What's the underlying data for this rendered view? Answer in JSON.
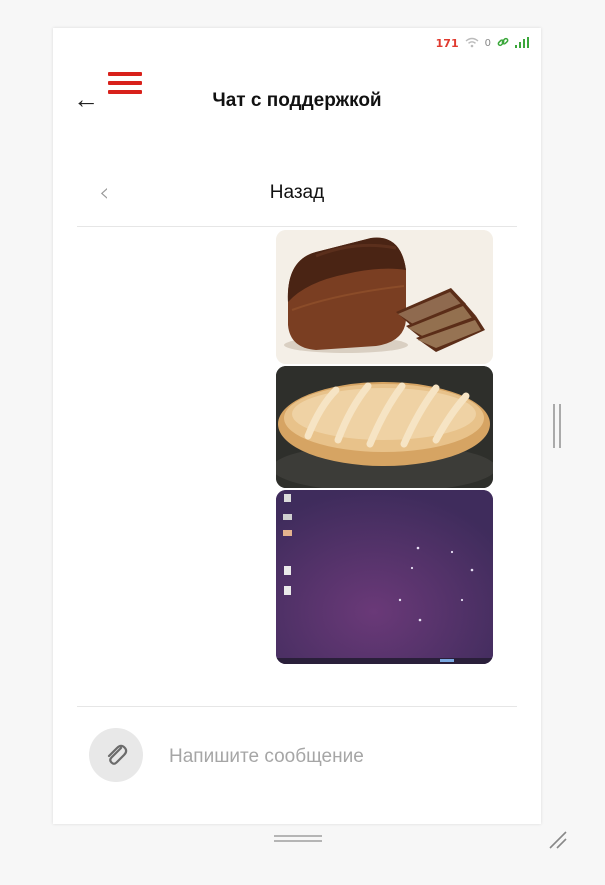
{
  "status_bar": {
    "counter": "171",
    "wifi_icon": "wifi-icon",
    "data": "0",
    "link_icon": "link-icon",
    "signal_icon": "signal-icon"
  },
  "header": {
    "title": "Чат с поддержкой",
    "back_icon": "arrow-left-icon",
    "menu_icon": "hamburger-menu-icon",
    "menu_color": "#d8211b"
  },
  "nav": {
    "chevron_icon": "chevron-left-icon",
    "title": "Назад"
  },
  "messages": [
    {
      "type": "image",
      "depicts": "brown bread loaf with slices"
    },
    {
      "type": "image",
      "depicts": "white bread loaf"
    },
    {
      "type": "image",
      "depicts": "purple desktop screenshot"
    }
  ],
  "composer": {
    "attach_icon": "paperclip-icon",
    "placeholder": "Напишите сообщение"
  }
}
